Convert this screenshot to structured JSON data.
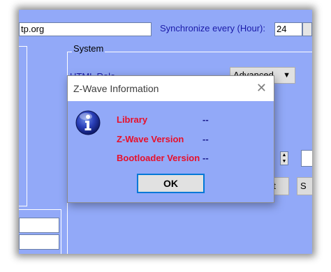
{
  "background": {
    "ntp_server_value": "tp.org",
    "sync_label": "Synchronize every (Hour):",
    "sync_value": "24",
    "system_group_label": "System",
    "html_role_label": "HTML Role",
    "html_role_value": "Advanced",
    "button_partial_1": "t",
    "button_partial_2": "S"
  },
  "dialog": {
    "title": "Z-Wave Information",
    "close_glyph": "✕",
    "rows": [
      {
        "label": "Library",
        "value": "--"
      },
      {
        "label": "Z-Wave Version",
        "value": "--"
      },
      {
        "label": "Bootloader Version",
        "value": "--"
      }
    ],
    "ok_label": "OK"
  },
  "colors": {
    "app_background": "#92a9f8",
    "label_red": "#e8102a",
    "value_navy": "#1a1a8c",
    "focus_blue": "#0078d7"
  },
  "icons": {
    "dialog_icon": "info-icon"
  }
}
